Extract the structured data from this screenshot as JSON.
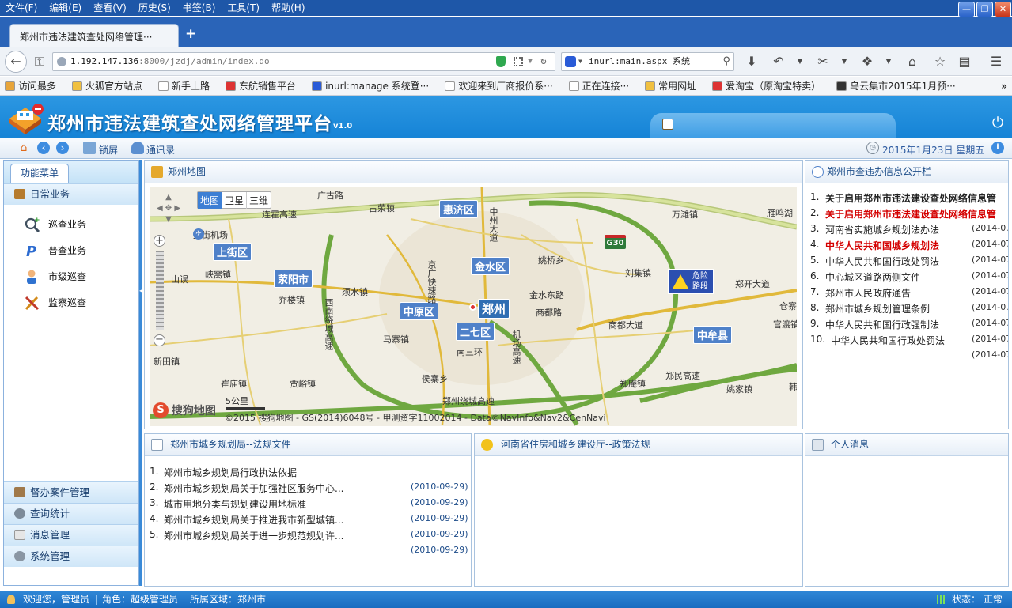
{
  "browser": {
    "menu": [
      "文件(F)",
      "编辑(E)",
      "查看(V)",
      "历史(S)",
      "书签(B)",
      "工具(T)",
      "帮助(H)"
    ],
    "tab_title": "郑州市违法建筑查处网络管理···",
    "url": "1.192.147.136:8000/jzdj/admin/index.do",
    "url_host": "1.192.147.136",
    "url_rest": ":8000/jzdj/admin/index.do",
    "search_text": "inurl:main.aspx 系统",
    "bookmarks": [
      "访问最多",
      "火狐官方站点",
      "新手上路",
      "东航销售平台",
      "inurl:manage 系统登···",
      "欢迎来到厂商报价系···",
      "正在连接···",
      "常用网址",
      "爱淘宝（原淘宝特卖）",
      "乌云集市2015年1月预···"
    ]
  },
  "app": {
    "title": "郑州市违法建筑查处网络管理平台",
    "version": "v1.0",
    "toolbar": {
      "lock": "锁屏",
      "contacts": "通讯录"
    },
    "date": "2015年1月23日 星期五"
  },
  "sidebar": {
    "tab": "功能菜单",
    "main_section": "日常业务",
    "items": [
      "巡查业务",
      "普查业务",
      "市级巡查",
      "监察巡查"
    ],
    "bottom_sections": [
      "督办案件管理",
      "查询统计",
      "消息管理",
      "系统管理"
    ]
  },
  "map_panel": {
    "title": "郑州地图",
    "map_types": [
      "地图",
      "卫星",
      "三维"
    ],
    "districts": [
      "惠济区",
      "上街区",
      "金水区",
      "荥阳市",
      "中原区",
      "郑州",
      "二七区",
      "中牟县"
    ],
    "places": [
      "广古路",
      "古荥镇",
      "中州大道",
      "万滩镇",
      "雁鸣湖",
      "上街机场",
      "峡窝镇",
      "姚桥乡",
      "刘集镇",
      "郑开大道",
      "山误",
      "乔楼镇",
      "须水镇",
      "金水东路",
      "商都路",
      "仓寨",
      "官渡镇",
      "马寨镇",
      "南三环",
      "商都大道",
      "新田镇",
      "崔庙镇",
      "贾峪镇",
      "侯寨乡",
      "郑庵镇",
      "姚家镇",
      "郑民高速",
      "连霍高速",
      "西南绕城高速",
      "机场高速",
      "郑州绕城高速",
      "京广快速路",
      "韩"
    ],
    "highway_shield": "G30",
    "danger_label": "危险路段",
    "scale": "5公里",
    "brand": "搜狗地图",
    "copyright": "©2015 搜狗地图 - GS(2014)6048号 - 甲测资字11002014 - Data©NavInfo&Nav2&CenNavi"
  },
  "notice_panel": {
    "title": "郑州市查违办信息公开栏",
    "items": [
      {
        "num": "1.",
        "text": "关于启用郑州市违法建设查处网络信息管",
        "date": "",
        "style": "bold"
      },
      {
        "num": "2.",
        "text": "关于启用郑州市违法建设查处网络信息管",
        "date": "",
        "style": "red"
      },
      {
        "num": "3.",
        "text": "河南省实施城乡规划法办法",
        "date": "(2014-07",
        "style": "normal"
      },
      {
        "num": "4.",
        "text": "中华人民共和国城乡规划法",
        "date": "(2014-07",
        "style": "red"
      },
      {
        "num": "5.",
        "text": "中华人民共和国行政处罚法",
        "date": "(2014-07",
        "style": "normal"
      },
      {
        "num": "6.",
        "text": "中心城区道路两侧文件",
        "date": "(2014-07",
        "style": "normal"
      },
      {
        "num": "7.",
        "text": "郑州市人民政府通告",
        "date": "(2014-07",
        "style": "normal"
      },
      {
        "num": "8.",
        "text": "郑州市城乡规划管理条例",
        "date": "(2014-07",
        "style": "normal"
      },
      {
        "num": "9.",
        "text": "中华人民共和国行政强制法",
        "date": "(2014-07",
        "style": "normal"
      },
      {
        "num": "10.",
        "text": "中华人民共和国行政处罚法",
        "date": "(2014-07",
        "style": "normal"
      }
    ],
    "extra_date": "(2014-07"
  },
  "planning_panel": {
    "title": "郑州市城乡规划局--法规文件",
    "items": [
      {
        "num": "1.",
        "text": "郑州市城乡规划局行政执法依据",
        "date": ""
      },
      {
        "num": "2.",
        "text": "郑州市城乡规划局关于加强社区服务中心...",
        "date": "(2010-09-29)"
      },
      {
        "num": "3.",
        "text": "城市用地分类与规划建设用地标准",
        "date": "(2010-09-29)"
      },
      {
        "num": "4.",
        "text": "郑州市城乡规划局关于推进我市新型城镇...",
        "date": "(2010-09-29)"
      },
      {
        "num": "5.",
        "text": "郑州市城乡规划局关于进一步规范规划许...",
        "date": "(2010-09-29)"
      }
    ],
    "extra_date": "(2010-09-29)"
  },
  "policy_panel": {
    "title": "河南省住房和城乡建设厅--政策法规"
  },
  "message_panel": {
    "title": "个人消息"
  },
  "status": {
    "welcome": "欢迎您，管理员",
    "role": "角色：超级管理员",
    "region": "所属区域：郑州市",
    "state": "状态： 正常"
  },
  "colors": {
    "accent": "#1e84d8",
    "red_link": "#d40000",
    "link_blue": "#1f4d8a"
  }
}
